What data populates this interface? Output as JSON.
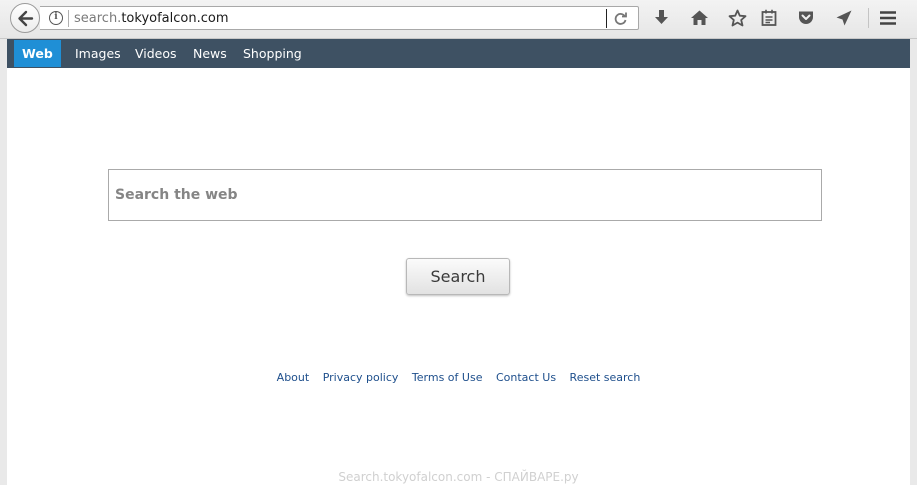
{
  "browser": {
    "url_prefix": "search.",
    "url_host": "tokyofalcon.com"
  },
  "nav": {
    "items": [
      {
        "label": "Web",
        "active": true
      },
      {
        "label": "Images"
      },
      {
        "label": "Videos"
      },
      {
        "label": "News"
      },
      {
        "label": "Shopping"
      }
    ]
  },
  "search": {
    "placeholder": "Search the web",
    "button_label": "Search"
  },
  "footer": {
    "links": [
      "About",
      "Privacy policy",
      "Terms of Use",
      "Contact Us",
      "Reset search"
    ]
  },
  "watermark": "Search.tokyofalcon.com - СПАЙВАРЕ.ру",
  "colors": {
    "nav_bg": "#3e5163",
    "nav_active": "#1f8fd6",
    "link": "#1e4f8c"
  },
  "icons": [
    "back-arrow-icon",
    "info-icon",
    "reload-icon",
    "download-icon",
    "home-icon",
    "bookmark-star-icon",
    "reading-list-icon",
    "pocket-icon",
    "send-tab-icon",
    "hamburger-menu-icon"
  ]
}
